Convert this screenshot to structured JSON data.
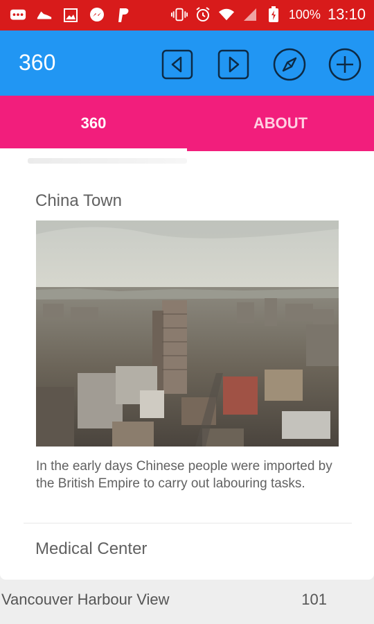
{
  "status_bar": {
    "battery_percent": "100%",
    "time": "13:10",
    "left_icons": [
      "chat-notification-icon",
      "shoe-icon",
      "image-icon",
      "messenger-icon",
      "paypal-icon"
    ],
    "right_icons": [
      "vibrate-icon",
      "alarm-icon",
      "wifi-icon",
      "signal-icon",
      "battery-icon"
    ]
  },
  "app_bar": {
    "title": "360",
    "actions": [
      "previous-icon",
      "next-icon",
      "compass-icon",
      "add-icon"
    ]
  },
  "tabs": [
    {
      "label": "360",
      "selected": true
    },
    {
      "label": "ABOUT",
      "selected": false
    }
  ],
  "cards": [
    {
      "title": "China Town",
      "image": "aerial-city-photo",
      "description": "In the early days Chinese people were imported by the British Empire to carry out labouring tasks."
    },
    {
      "title": "Medical Center"
    }
  ],
  "bottom_item": {
    "name": "Vancouver Harbour View",
    "number": "101"
  },
  "colors": {
    "status_bar": "#d81b1b",
    "app_bar": "#2196f3",
    "tab_bar": "#f21e7c"
  }
}
